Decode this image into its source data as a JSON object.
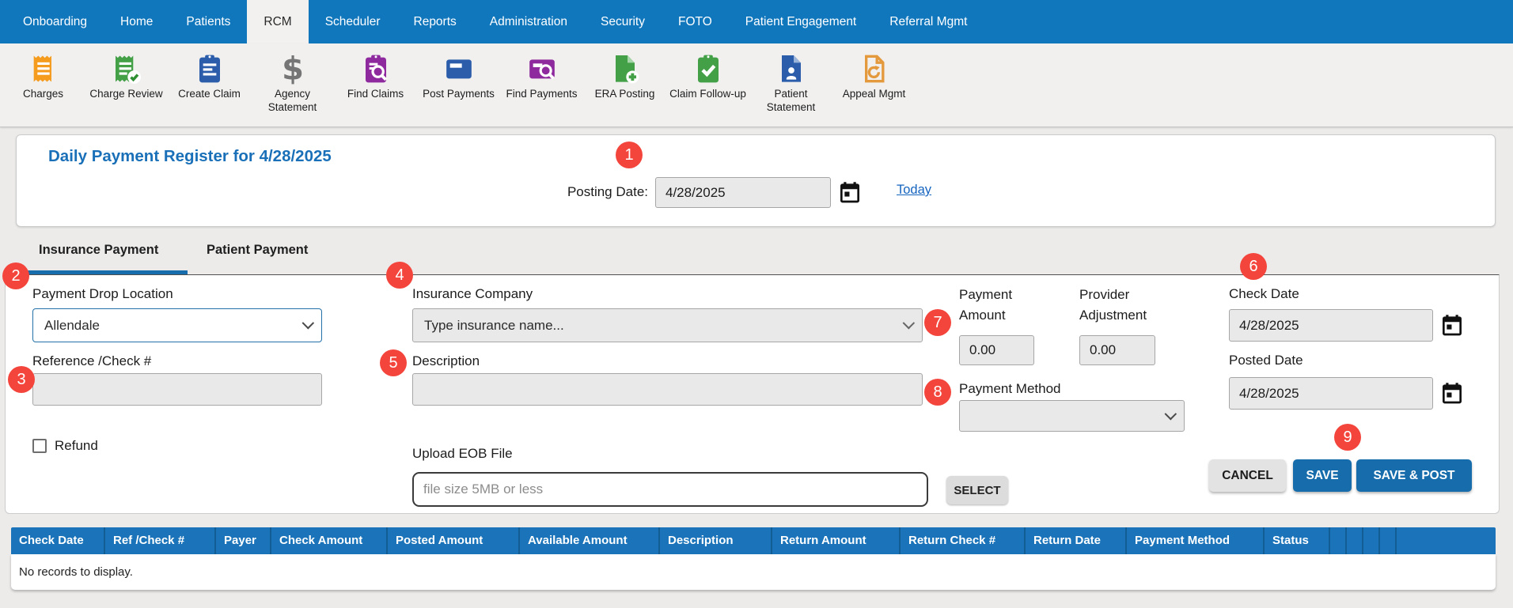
{
  "nav": {
    "active": "RCM",
    "items": [
      {
        "label": "Onboarding"
      },
      {
        "label": "Home"
      },
      {
        "label": "Patients"
      },
      {
        "label": "RCM"
      },
      {
        "label": "Scheduler"
      },
      {
        "label": "Reports"
      },
      {
        "label": "Administration"
      },
      {
        "label": "Security"
      },
      {
        "label": "FOTO"
      },
      {
        "label": "Patient Engagement"
      },
      {
        "label": "Referral Mgmt"
      }
    ]
  },
  "toolbar": {
    "items": [
      {
        "label": "Charges",
        "icon": "receipt-icon"
      },
      {
        "label": "Charge Review",
        "icon": "receipt-check-icon"
      },
      {
        "label": "Create Claim",
        "icon": "clipboard-icon"
      },
      {
        "label": "Agency Statement",
        "icon": "dollar-icon"
      },
      {
        "label": "Find Claims",
        "icon": "clipboard-search-icon"
      },
      {
        "label": "Post Payments",
        "icon": "credit-card-icon"
      },
      {
        "label": "Find Payments",
        "icon": "card-search-icon"
      },
      {
        "label": "ERA Posting",
        "icon": "file-plus-icon"
      },
      {
        "label": "Claim Follow-up",
        "icon": "clipboard-check-icon"
      },
      {
        "label": "Patient Statement",
        "icon": "file-person-icon"
      },
      {
        "label": "Appeal Mgmt",
        "icon": "file-undo-icon"
      }
    ]
  },
  "register": {
    "title": "Daily Payment Register for 4/28/2025",
    "posting_date_label": "Posting Date:",
    "posting_date_value": "4/28/2025",
    "today_link": "Today"
  },
  "tabs": {
    "items": [
      {
        "label": "Insurance Payment",
        "active": true
      },
      {
        "label": "Patient Payment",
        "active": false
      }
    ]
  },
  "form": {
    "payment_drop_location_label": "Payment Drop Location",
    "payment_drop_location_value": "Allendale",
    "reference_label": "Reference /Check #",
    "reference_value": "",
    "refund_label": "Refund",
    "refund_checked": false,
    "insurance_company_label": "Insurance Company",
    "insurance_company_value": "Type insurance name...",
    "description_label": "Description",
    "description_value": "",
    "upload_eob_label": "Upload EOB File",
    "upload_eob_placeholder": "file size 5MB or less",
    "select_button": "SELECT",
    "payment_amount_label": "Payment Amount",
    "payment_amount_value": "0.00",
    "provider_adjustment_label": "Provider Adjustment",
    "provider_adjustment_value": "0.00",
    "payment_method_label": "Payment Method",
    "payment_method_value": "",
    "check_date_label": "Check Date",
    "check_date_value": "4/28/2025",
    "posted_date_label": "Posted Date",
    "posted_date_value": "4/28/2025",
    "cancel_button": "CANCEL",
    "save_button": "SAVE",
    "save_post_button": "SAVE & POST"
  },
  "grid": {
    "columns": [
      "Check Date",
      "Ref /Check #",
      "Payer",
      "Check Amount",
      "Posted Amount",
      "Available Amount",
      "Description",
      "Return Amount",
      "Return Check #",
      "Return Date",
      "Payment Method",
      "Status"
    ],
    "empty_message": "No records to display."
  },
  "annotations": {
    "badges": [
      "1",
      "2",
      "3",
      "4",
      "5",
      "6",
      "7",
      "8",
      "9"
    ]
  },
  "colors": {
    "nav_blue": "#1177bd",
    "table_header_blue": "#1b74b9",
    "accent_blue": "#176cab",
    "title_blue": "#1a70b8",
    "link_blue": "#1564c0",
    "badge_red": "#f4453c",
    "input_gray": "#e9e9e9",
    "toolbar_gray": "#f1f0ef"
  }
}
